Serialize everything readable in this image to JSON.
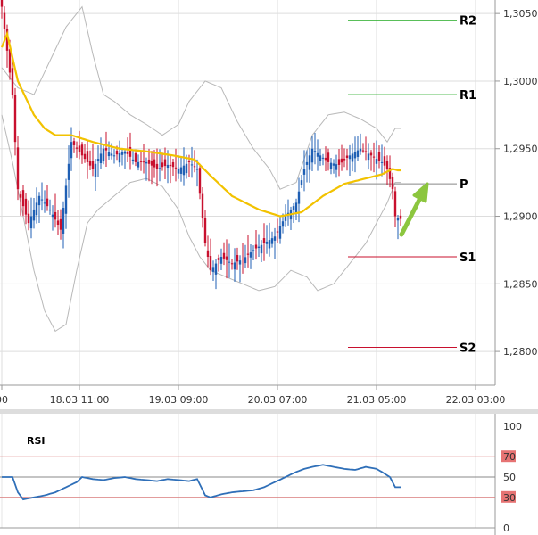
{
  "chart_data": [
    {
      "type": "candlestick",
      "ylim": [
        1.2775,
        1.306
      ],
      "y_ticks": [
        "1,3050",
        "1,3000",
        "1,2950",
        "1,2900",
        "1,2850",
        "1,2800"
      ],
      "y_tick_values": [
        1.305,
        1.3,
        1.295,
        1.29,
        1.285,
        1.28
      ],
      "x_ticks": [
        "00",
        "18.03 11:00",
        "19.03 09:00",
        "20.03 07:00",
        "21.03 05:00",
        "22.03 03:00"
      ],
      "bar_count": 150,
      "x_tick_bars": [
        0,
        29,
        66,
        103,
        140,
        177
      ],
      "grid": true,
      "colors": {
        "up": "#1f5fb4",
        "down": "#c8102e",
        "ma": "#f2c200",
        "bands": "#b8b8b8",
        "support": "#c8102e",
        "resistance": "#22aa22",
        "arrow": "#8cc63f"
      },
      "pivot_levels": [
        {
          "label": "R2",
          "value": 1.3045,
          "color": "#22aa22"
        },
        {
          "label": "R1",
          "value": 1.299,
          "color": "#22aa22"
        },
        {
          "label": "P",
          "value": 1.2924,
          "color": "#888888"
        },
        {
          "label": "S1",
          "value": 1.287,
          "color": "#c8102e"
        },
        {
          "label": "S2",
          "value": 1.2803,
          "color": "#c8102e"
        }
      ],
      "price_anchors": [
        [
          0,
          1.3055
        ],
        [
          4,
          1.299
        ],
        [
          6,
          1.292
        ],
        [
          10,
          1.2895
        ],
        [
          14,
          1.2915
        ],
        [
          18,
          1.2905
        ],
        [
          22,
          1.289
        ],
        [
          26,
          1.2955
        ],
        [
          30,
          1.2945
        ],
        [
          34,
          1.2935
        ],
        [
          38,
          1.295
        ],
        [
          42,
          1.2945
        ],
        [
          46,
          1.2948
        ],
        [
          50,
          1.294
        ],
        [
          54,
          1.294
        ],
        [
          58,
          1.2935
        ],
        [
          62,
          1.2938
        ],
        [
          66,
          1.2935
        ],
        [
          70,
          1.294
        ],
        [
          73,
          1.2935
        ],
        [
          76,
          1.288
        ],
        [
          78,
          1.286
        ],
        [
          82,
          1.287
        ],
        [
          86,
          1.2865
        ],
        [
          90,
          1.2868
        ],
        [
          94,
          1.2875
        ],
        [
          98,
          1.288
        ],
        [
          102,
          1.2885
        ],
        [
          106,
          1.29
        ],
        [
          110,
          1.291
        ],
        [
          113,
          1.2935
        ],
        [
          116,
          1.295
        ],
        [
          119,
          1.2945
        ],
        [
          122,
          1.294
        ],
        [
          126,
          1.2938
        ],
        [
          130,
          1.2945
        ],
        [
          134,
          1.295
        ],
        [
          138,
          1.2945
        ],
        [
          142,
          1.294
        ],
        [
          144,
          1.2935
        ],
        [
          146,
          1.292
        ],
        [
          147,
          1.29
        ],
        [
          149,
          1.2898
        ]
      ],
      "ma_anchors": [
        [
          0,
          1.3025
        ],
        [
          2,
          1.3035
        ],
        [
          6,
          1.3
        ],
        [
          12,
          1.2975
        ],
        [
          16,
          1.2965
        ],
        [
          20,
          1.296
        ],
        [
          26,
          1.296
        ],
        [
          34,
          1.2955
        ],
        [
          44,
          1.295
        ],
        [
          54,
          1.2948
        ],
        [
          64,
          1.2945
        ],
        [
          72,
          1.2942
        ],
        [
          78,
          1.293
        ],
        [
          86,
          1.2915
        ],
        [
          96,
          1.2905
        ],
        [
          104,
          1.29
        ],
        [
          112,
          1.2903
        ],
        [
          120,
          1.2915
        ],
        [
          128,
          1.2924
        ],
        [
          136,
          1.2928
        ],
        [
          142,
          1.2931
        ],
        [
          146,
          1.2935
        ],
        [
          148,
          1.2934
        ]
      ],
      "upper_band_anchors": [
        [
          0,
          1.301
        ],
        [
          6,
          1.2995
        ],
        [
          12,
          1.299
        ],
        [
          18,
          1.3015
        ],
        [
          24,
          1.304
        ],
        [
          30,
          1.3055
        ],
        [
          34,
          1.302
        ],
        [
          38,
          1.299
        ],
        [
          42,
          1.2985
        ],
        [
          48,
          1.2975
        ],
        [
          54,
          1.2968
        ],
        [
          60,
          1.296
        ],
        [
          66,
          1.2968
        ],
        [
          70,
          1.2985
        ],
        [
          76,
          1.3
        ],
        [
          82,
          1.2995
        ],
        [
          88,
          1.297
        ],
        [
          94,
          1.295
        ],
        [
          100,
          1.2935
        ],
        [
          104,
          1.292
        ],
        [
          110,
          1.2925
        ],
        [
          116,
          1.296
        ],
        [
          122,
          1.2975
        ],
        [
          128,
          1.2977
        ],
        [
          134,
          1.2972
        ],
        [
          140,
          1.2965
        ],
        [
          144,
          1.2955
        ],
        [
          147,
          1.2965
        ]
      ],
      "lower_band_anchors": [
        [
          0,
          1.2975
        ],
        [
          4,
          1.294
        ],
        [
          8,
          1.29
        ],
        [
          12,
          1.286
        ],
        [
          16,
          1.283
        ],
        [
          20,
          1.2815
        ],
        [
          24,
          1.282
        ],
        [
          28,
          1.286
        ],
        [
          32,
          1.2895
        ],
        [
          36,
          1.2905
        ],
        [
          42,
          1.2915
        ],
        [
          48,
          1.2925
        ],
        [
          54,
          1.2928
        ],
        [
          60,
          1.2922
        ],
        [
          66,
          1.2905
        ],
        [
          70,
          1.2885
        ],
        [
          74,
          1.287
        ],
        [
          78,
          1.286
        ],
        [
          84,
          1.2855
        ],
        [
          90,
          1.285
        ],
        [
          96,
          1.2845
        ],
        [
          102,
          1.2848
        ],
        [
          108,
          1.286
        ],
        [
          114,
          1.2855
        ],
        [
          118,
          1.2845
        ],
        [
          124,
          1.285
        ],
        [
          130,
          1.2865
        ],
        [
          136,
          1.288
        ],
        [
          140,
          1.2895
        ],
        [
          144,
          1.291
        ],
        [
          147,
          1.2925
        ]
      ]
    },
    {
      "type": "line",
      "title": "RSI",
      "ylim": [
        0,
        100
      ],
      "y_ticks": [
        100,
        70,
        50,
        30,
        0
      ],
      "highlight_ticks": [
        70,
        30
      ],
      "levels": [
        70,
        50,
        30
      ],
      "colors": {
        "line": "#2f6fb8",
        "level": "#d97c7c",
        "mid": "#888888"
      },
      "series": [
        {
          "anchors": [
            [
              0,
              50
            ],
            [
              4,
              50
            ],
            [
              6,
              35
            ],
            [
              8,
              28
            ],
            [
              12,
              30
            ],
            [
              16,
              32
            ],
            [
              20,
              35
            ],
            [
              24,
              40
            ],
            [
              28,
              45
            ],
            [
              30,
              50
            ],
            [
              34,
              48
            ],
            [
              38,
              47
            ],
            [
              42,
              49
            ],
            [
              46,
              50
            ],
            [
              50,
              48
            ],
            [
              54,
              47
            ],
            [
              58,
              46
            ],
            [
              62,
              48
            ],
            [
              66,
              47
            ],
            [
              70,
              46
            ],
            [
              73,
              48
            ],
            [
              76,
              32
            ],
            [
              78,
              30
            ],
            [
              82,
              33
            ],
            [
              86,
              35
            ],
            [
              90,
              36
            ],
            [
              94,
              37
            ],
            [
              98,
              40
            ],
            [
              102,
              45
            ],
            [
              106,
              50
            ],
            [
              110,
              55
            ],
            [
              113,
              58
            ],
            [
              116,
              60
            ],
            [
              120,
              62
            ],
            [
              124,
              60
            ],
            [
              128,
              58
            ],
            [
              132,
              57
            ],
            [
              136,
              60
            ],
            [
              140,
              58
            ],
            [
              142,
              55
            ],
            [
              145,
              50
            ],
            [
              147,
              40
            ]
          ]
        }
      ]
    }
  ]
}
